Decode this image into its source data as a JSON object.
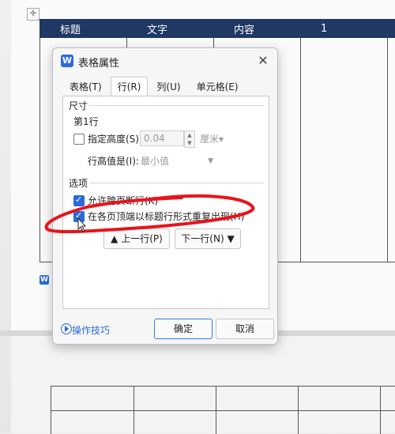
{
  "document": {
    "table_headers": [
      "标题",
      "文字",
      "内容",
      "1"
    ]
  },
  "dialog": {
    "title": "表格属性",
    "app_icon_letter": "W",
    "tabs": [
      {
        "label": "表格(T)",
        "active": false
      },
      {
        "label": "行(R)",
        "active": true
      },
      {
        "label": "列(U)",
        "active": false
      },
      {
        "label": "单元格(E)",
        "active": false
      }
    ],
    "size_section": {
      "label": "尺寸",
      "row_label": "第1行",
      "specify_height": {
        "label": "指定高度(S):",
        "checked": false
      },
      "height_value": "0.04",
      "height_unit": "厘米▾",
      "row_height_is_label": "行高值是(I):",
      "row_height_is_value": "最小值"
    },
    "options_section": {
      "label": "选项",
      "allow_break": {
        "label": "允许跨页断行(K)",
        "checked": true
      },
      "repeat_header": {
        "label": "在各页顶端以标题行形式重复出现(H)",
        "checked": true
      }
    },
    "prev_row_label": "▲ 上一行(P)",
    "next_row_label": "下一行(N) ▼",
    "tips_label": "操作技巧",
    "ok_label": "确定",
    "cancel_label": "取消"
  },
  "colors": {
    "header_bg": "#1f3864",
    "accent": "#2b6bd9",
    "annotation": "#e8141c"
  }
}
